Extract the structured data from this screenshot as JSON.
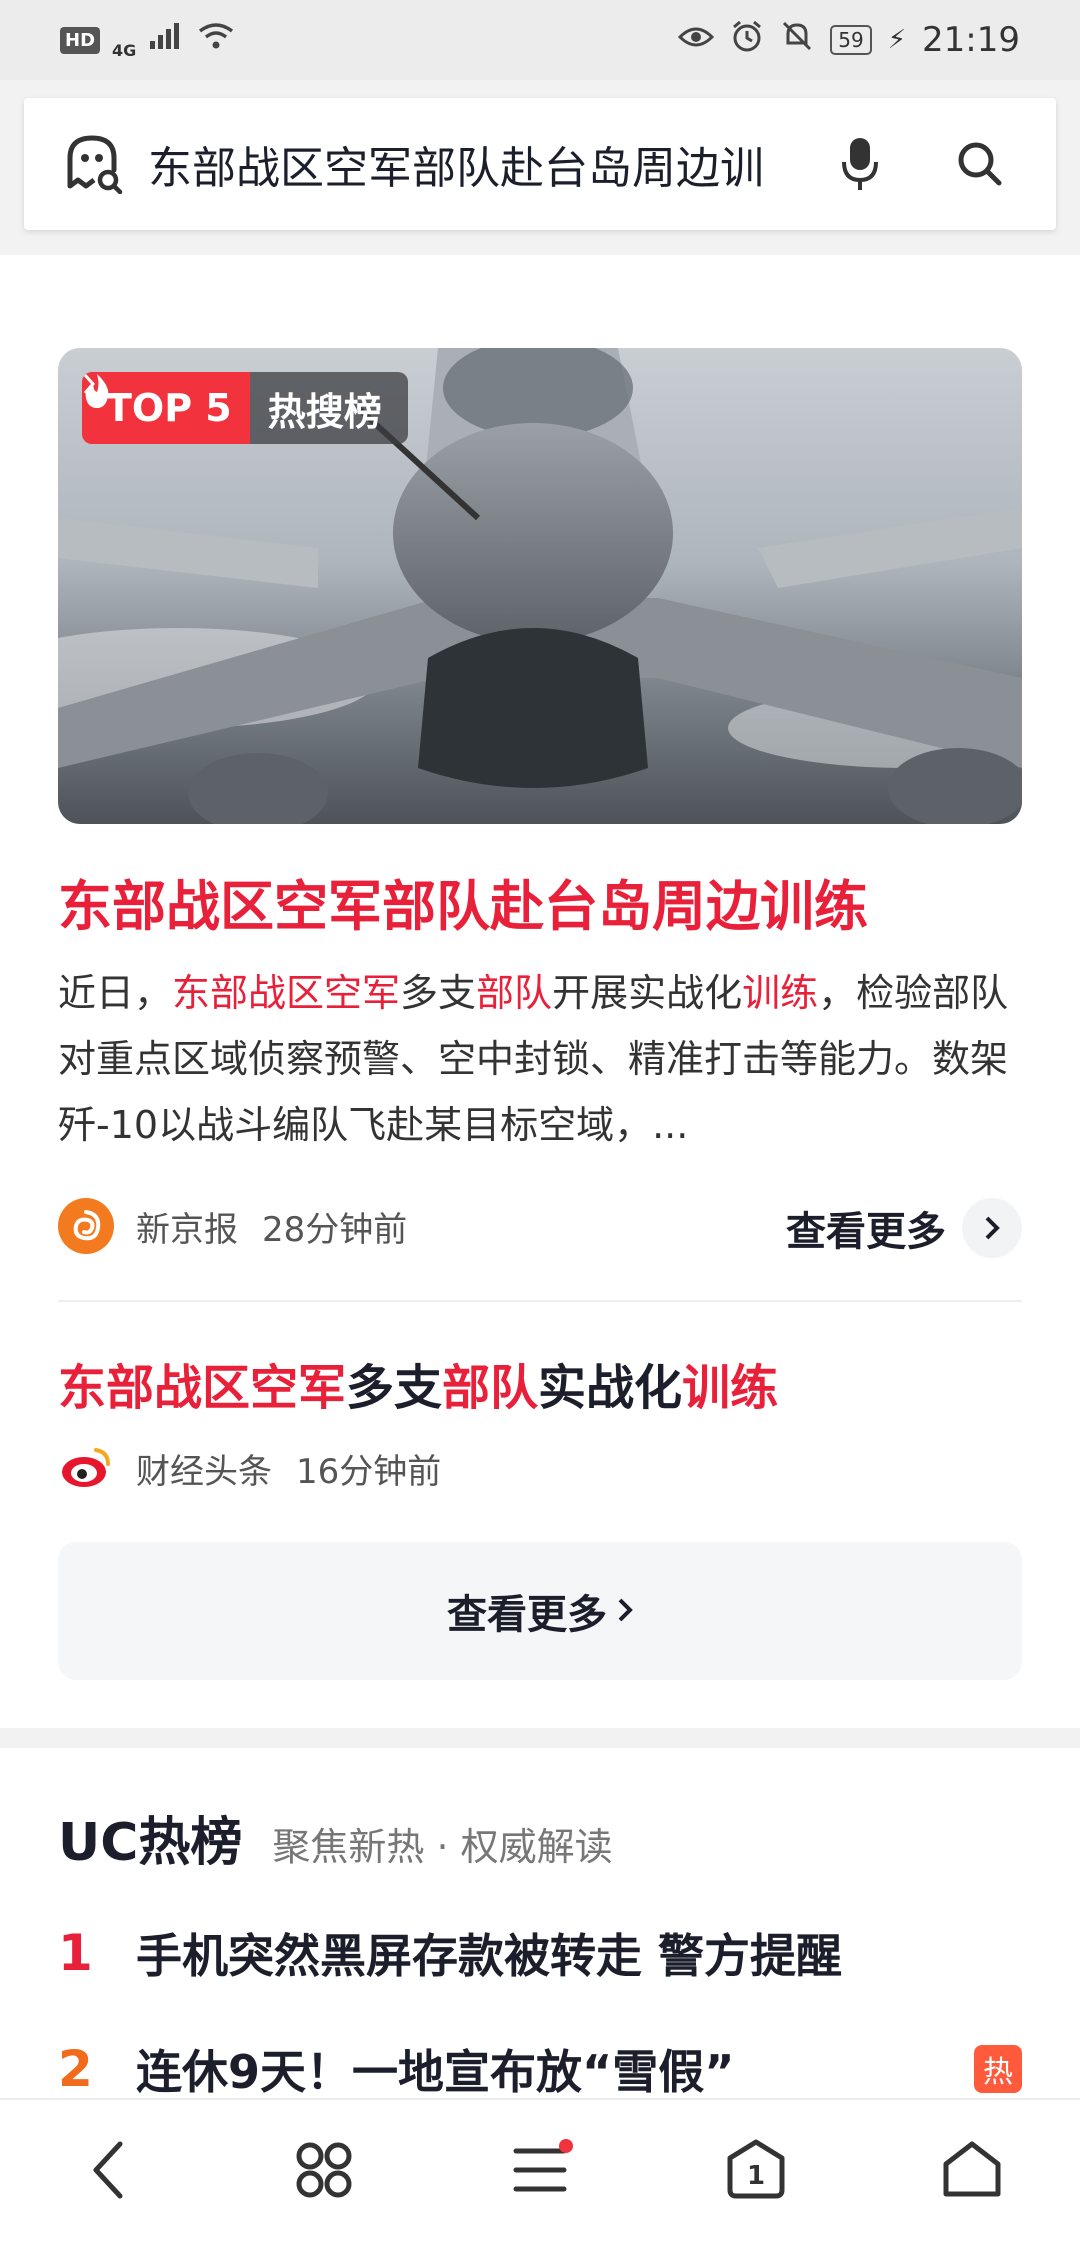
{
  "status_bar": {
    "hd": "HD",
    "network": "4G",
    "battery": "59",
    "time": "21:19"
  },
  "search": {
    "query": "东部战区空军部队赴台岛周边训"
  },
  "hero": {
    "badge_top": "TOP 5",
    "badge_board": "热搜榜",
    "headline": "东部战区空军部队赴台岛周边训练",
    "summary": {
      "p1": "近日，",
      "h1": "东部战区空军",
      "p2": "多支",
      "h2": "部队",
      "p3": "开展实战化",
      "h3": "训练",
      "p4": "，检验部队对重点区域侦察预警、空中封锁、精准打击等能力。数架歼-10以战斗编队飞赴某目标空域，..."
    },
    "source": "新京报",
    "time": "28分钟前",
    "more_label": "查看更多"
  },
  "secondary": {
    "h1": "东部战区空军",
    "p1": "多支",
    "h2": "部队",
    "p2": "实战化",
    "h3": "训练",
    "source": "财经头条",
    "time": "16分钟前"
  },
  "view_more_button": "查看更多",
  "uc_hot": {
    "title": "UC热榜",
    "subtitle": "聚焦新热 · 权威解读",
    "items": [
      {
        "rank": "1",
        "text": "手机突然黑屏存款被转走 警方提醒",
        "color": "#e8203a"
      },
      {
        "rank": "2",
        "text": "连休9天！一地宣布放“雪假”",
        "color": "#f26b1d",
        "tag": "热"
      }
    ]
  },
  "colors": {
    "accent_red": "#e8203a",
    "badge_red": "#f2323c"
  }
}
